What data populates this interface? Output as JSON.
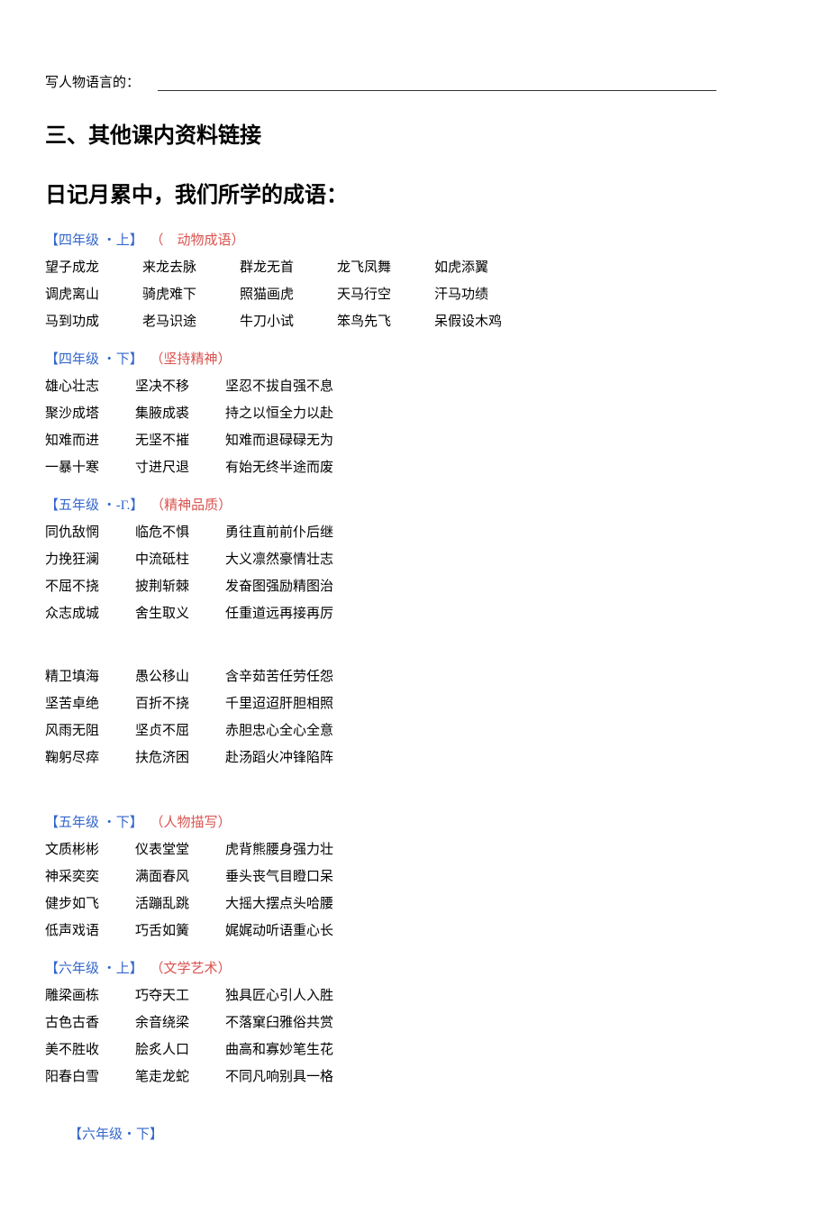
{
  "intro_line": "写人物语言的：",
  "heading1": "三、其他课内资料链接",
  "heading2": "日记月累中，我们所学的成语：",
  "groups": [
    {
      "header_grade": "【四年级 ・上】",
      "header_paren": "（　动物成语）",
      "layout": "five",
      "rows": [
        [
          "望子成龙",
          "来龙去脉",
          "群龙无首",
          "龙飞凤舞",
          "如虎添翼"
        ],
        [
          "调虎离山",
          "骑虎难下",
          "照猫画虎",
          "天马行空",
          "汗马功绩"
        ],
        [
          "马到功成",
          "老马识途",
          "牛刀小试",
          "笨鸟先飞",
          "呆假设木鸡"
        ]
      ]
    },
    {
      "header_grade": "【四年级 ・下】",
      "header_paren": "（坚持精神）",
      "layout": "three",
      "rows": [
        [
          "雄心壮志",
          "坚决不移",
          "坚忍不拔自强不息"
        ],
        [
          "聚沙成塔",
          "集腋成裘",
          "持之以恒全力以赴"
        ],
        [
          "知难而进",
          "无坚不摧",
          "知难而退碌碌无为"
        ],
        [
          "一暴十寒",
          "寸进尺退",
          "有始无终半途而废"
        ]
      ]
    },
    {
      "header_grade": "【五年级 ・-Γ.】",
      "header_paren": "（精神品质）",
      "layout": "three",
      "rows": [
        [
          "同仇敌惘",
          "临危不惧",
          "勇往直前前仆后继"
        ],
        [
          "力挽狂澜",
          "中流砥柱",
          "大义凛然豪情壮志"
        ],
        [
          "不屈不挠",
          "披荆斩棘",
          "发奋图强励精图治"
        ],
        [
          "众志成城",
          "舍生取义",
          "任重道远再接再厉"
        ]
      ],
      "rows2": [
        [
          "精卫填海",
          "愚公移山",
          "含辛茹苦任劳任怨"
        ],
        [
          "坚苦卓绝",
          "百折不挠",
          "千里迢迢肝胆相照"
        ],
        [
          "风雨无阻",
          "坚贞不屈",
          "赤胆忠心全心全意"
        ],
        [
          "鞠躬尽瘁",
          "扶危济困",
          "赴汤蹈火冲锋陷阵"
        ]
      ]
    },
    {
      "header_grade": "【五年级 ・下】",
      "header_paren": "（人物描写）",
      "layout": "three",
      "rows": [
        [
          "文质彬彬",
          "仪表堂堂",
          "虎背熊腰身强力壮"
        ],
        [
          "神采奕奕",
          "满面春风",
          "垂头丧气目瞪口呆"
        ],
        [
          "健步如飞",
          "活蹦乱跳",
          "大摇大摆点头哈腰"
        ],
        [
          "低声戏语",
          "巧舌如簧",
          "娓娓动听语重心长"
        ]
      ]
    },
    {
      "header_grade": "【六年级 ・上】",
      "header_paren": "（文学艺术）",
      "layout": "three",
      "rows": [
        [
          "雕梁画栋",
          "巧夺天工",
          "独具匠心引人入胜"
        ],
        [
          "古色古香",
          "余音绕梁",
          "不落窠臼雅俗共赏"
        ],
        [
          "美不胜收",
          "脍炙人口",
          "曲高和寡妙笔生花"
        ],
        [
          "阳春白雪",
          "笔走龙蛇",
          "不同凡响别具一格"
        ]
      ]
    }
  ],
  "footer_grade": "【六年级・下】"
}
